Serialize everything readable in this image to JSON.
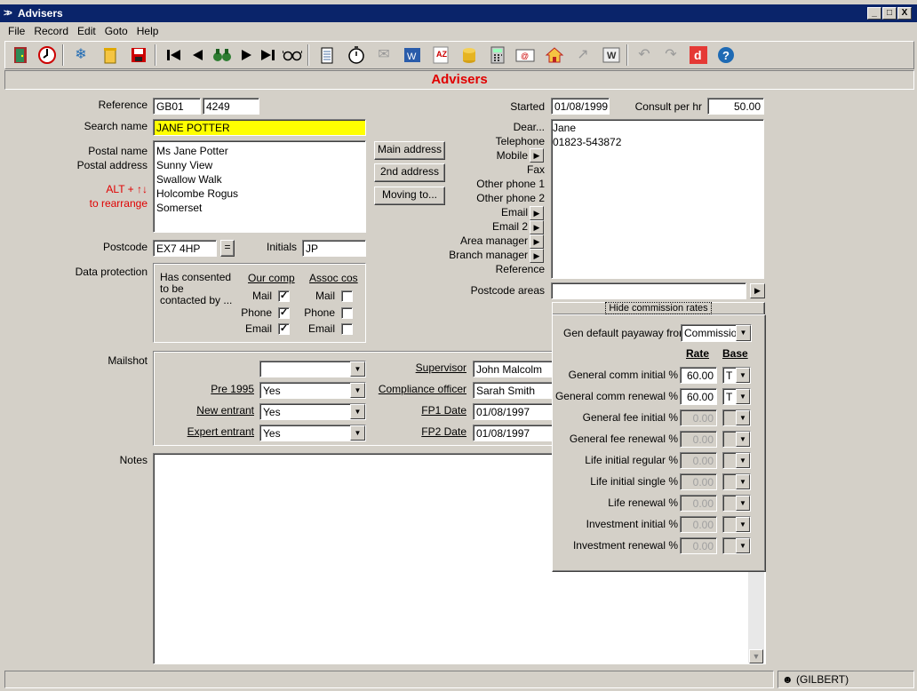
{
  "window": {
    "title": "Advisers",
    "min": "_",
    "max": "□",
    "close": "X"
  },
  "menu": [
    "File",
    "Record",
    "Edit",
    "Goto",
    "Help"
  ],
  "toolbar_icons": [
    "exit-door-icon",
    "power-icon",
    "snowflake-icon",
    "trash-icon",
    "save-icon",
    "first-record-icon",
    "previous-record-icon",
    "find-icon",
    "next-record-icon",
    "last-record-icon",
    "glasses-icon",
    "notepad-icon",
    "stopwatch-icon",
    "papers-icon",
    "word-icon",
    "sort-icon",
    "coins-icon",
    "calculator-icon",
    "email-icon",
    "house-icon",
    "chart-icon",
    "words-icon",
    "undo-icon",
    "redo-icon",
    "d-logo-icon",
    "help-icon"
  ],
  "form_title": "Advisers",
  "reference": {
    "label": "Reference",
    "code": "GB01",
    "number": "4249"
  },
  "search_name": {
    "label": "Search name",
    "value": "JANE POTTER"
  },
  "postal": {
    "label1": "Postal name",
    "label2": "Postal address",
    "hint1": "ALT +  ↑↓",
    "hint2": "to rearrange",
    "lines": [
      "Ms Jane Potter",
      "Sunny View",
      "Swallow Walk",
      "Holcombe Rogus",
      "Somerset"
    ]
  },
  "address_buttons": {
    "main": "Main address",
    "second": "2nd address",
    "moving": "Moving to..."
  },
  "postcode": {
    "label": "Postcode",
    "value": "EX7 4HP",
    "button": "="
  },
  "initials": {
    "label": "Initials",
    "value": "JP"
  },
  "data_protection": {
    "label": "Data protection",
    "text": "Has consented to be contacted by ...",
    "our_comp": "Our comp",
    "assoc_cos": "Assoc cos",
    "rows": [
      {
        "label": "Mail",
        "our": "✓",
        "assoc": ""
      },
      {
        "label": "Phone",
        "our": "✓",
        "assoc": ""
      },
      {
        "label": "Email",
        "our": "✓",
        "assoc": ""
      }
    ]
  },
  "started": {
    "label": "Started",
    "value": "01/08/1999"
  },
  "consult": {
    "label": "Consult per hr",
    "value": "50.00"
  },
  "contact_labels": [
    "Dear...",
    "Telephone",
    "Mobile",
    "Fax",
    "Other phone 1",
    "Other phone 2",
    "Email",
    "Email 2",
    "Area manager",
    "Branch manager",
    "Reference"
  ],
  "contact_values": [
    "Jane",
    "01823-543872"
  ],
  "postcode_areas": {
    "label": "Postcode areas",
    "value": ""
  },
  "hide_commission": "Hide commission rates",
  "commission": {
    "payaway_label": "Gen default payaway from",
    "payaway_value": "Commission",
    "rate_header": "Rate",
    "base_header": "Base",
    "rows": [
      {
        "label": "General comm initial %",
        "rate": "60.00",
        "base": "T",
        "enabled": true
      },
      {
        "label": "General comm renewal %",
        "rate": "60.00",
        "base": "T",
        "enabled": true
      },
      {
        "label": "General fee initial %",
        "rate": "0.00",
        "base": "",
        "enabled": false
      },
      {
        "label": "General fee renewal %",
        "rate": "0.00",
        "base": "",
        "enabled": false
      },
      {
        "label": "Life initial regular %",
        "rate": "0.00",
        "base": "",
        "enabled": false
      },
      {
        "label": "Life initial single %",
        "rate": "0.00",
        "base": "",
        "enabled": false
      },
      {
        "label": "Life renewal %",
        "rate": "0.00",
        "base": "",
        "enabled": false
      },
      {
        "label": "Investment initial %",
        "rate": "0.00",
        "base": "",
        "enabled": false
      },
      {
        "label": "Investment renewal %",
        "rate": "0.00",
        "base": "",
        "enabled": false
      }
    ]
  },
  "mailshot": {
    "label": "Mailshot",
    "mailshot_value": "",
    "pre1995": {
      "label": "Pre 1995",
      "value": "Yes"
    },
    "new_entrant": {
      "label": "New entrant",
      "value": "Yes"
    },
    "expert_entrant": {
      "label": "Expert entrant",
      "value": "Yes"
    },
    "supervisor": {
      "label": "Supervisor",
      "value": "John Malcolm"
    },
    "compliance": {
      "label": "Compliance officer",
      "value": "Sarah Smith"
    },
    "fp1": {
      "label": "FP1 Date",
      "value": "01/08/1997"
    },
    "fp2": {
      "label": "FP2 Date",
      "value": "01/08/1997"
    }
  },
  "notes": {
    "label": "Notes",
    "value": ""
  },
  "status": {
    "user": "(GILBERT)"
  }
}
